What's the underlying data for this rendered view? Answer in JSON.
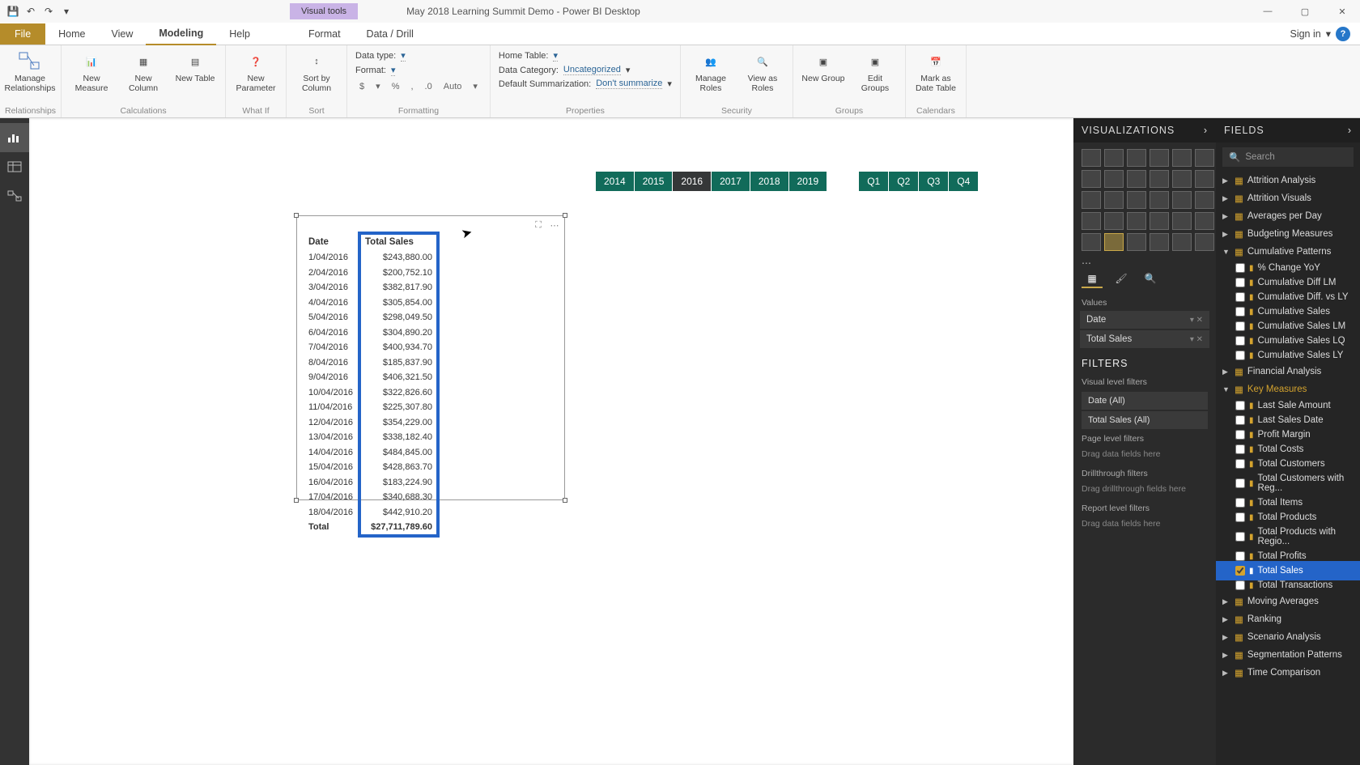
{
  "titlebar": {
    "contextual_label": "Visual tools",
    "title": "May 2018 Learning Summit Demo - Power BI Desktop"
  },
  "win_controls": {
    "min": "—",
    "max": "▢",
    "close": "✕"
  },
  "ribbon_tabs": {
    "file": "File",
    "home": "Home",
    "view": "View",
    "modeling": "Modeling",
    "help": "Help",
    "format": "Format",
    "data": "Data / Drill",
    "signin": "Sign in"
  },
  "ribbon": {
    "manage_rel": "Manage\nRelationships",
    "new_measure": "New\nMeasure",
    "new_column": "New\nColumn",
    "new_table": "New\nTable",
    "new_param": "New\nParameter",
    "sort_by": "Sort by\nColumn",
    "data_type_lbl": "Data type:",
    "format_lbl": "Format:",
    "auto": "Auto",
    "home_table_lbl": "Home Table:",
    "data_cat_lbl": "Data Category:",
    "data_cat_val": "Uncategorized",
    "summ_lbl": "Default Summarization:",
    "summ_val": "Don't summarize",
    "manage_roles": "Manage\nRoles",
    "view_as": "View as\nRoles",
    "new_group": "New\nGroup",
    "edit_groups": "Edit\nGroups",
    "mark_date": "Mark as\nDate Table",
    "groups": {
      "rel": "Relationships",
      "calc": "Calculations",
      "whatif": "What If",
      "sort": "Sort",
      "formatting": "Formatting",
      "props": "Properties",
      "security": "Security",
      "grps": "Groups",
      "cal": "Calendars"
    }
  },
  "slicers": {
    "years": [
      "2014",
      "2015",
      "2016",
      "2017",
      "2018",
      "2019"
    ],
    "quarters": [
      "Q1",
      "Q2",
      "Q3",
      "Q4"
    ],
    "year_off_index": 2
  },
  "table": {
    "head_date": "Date",
    "head_sales": "Total Sales",
    "total_label": "Total",
    "total_value": "$27,711,789.60",
    "rows": [
      {
        "d": "1/04/2016",
        "v": "$243,880.00"
      },
      {
        "d": "2/04/2016",
        "v": "$200,752.10"
      },
      {
        "d": "3/04/2016",
        "v": "$382,817.90"
      },
      {
        "d": "4/04/2016",
        "v": "$305,854.00"
      },
      {
        "d": "5/04/2016",
        "v": "$298,049.50"
      },
      {
        "d": "6/04/2016",
        "v": "$304,890.20"
      },
      {
        "d": "7/04/2016",
        "v": "$400,934.70"
      },
      {
        "d": "8/04/2016",
        "v": "$185,837.90"
      },
      {
        "d": "9/04/2016",
        "v": "$406,321.50"
      },
      {
        "d": "10/04/2016",
        "v": "$322,826.60"
      },
      {
        "d": "11/04/2016",
        "v": "$225,307.80"
      },
      {
        "d": "12/04/2016",
        "v": "$354,229.00"
      },
      {
        "d": "13/04/2016",
        "v": "$338,182.40"
      },
      {
        "d": "14/04/2016",
        "v": "$484,845.00"
      },
      {
        "d": "15/04/2016",
        "v": "$428,863.70"
      },
      {
        "d": "16/04/2016",
        "v": "$183,224.90"
      },
      {
        "d": "17/04/2016",
        "v": "$340,688.30"
      },
      {
        "d": "18/04/2016",
        "v": "$442,910.20"
      }
    ]
  },
  "viz": {
    "title": "VISUALIZATIONS",
    "values_lbl": "Values",
    "date": "Date",
    "total_sales": "Total Sales",
    "filters_lbl": "FILTERS",
    "vlf": "Visual level filters",
    "date_all": "Date (All)",
    "sales_all": "Total Sales (All)",
    "plf": "Page level filters",
    "drag": "Drag data fields here",
    "drill": "Drillthrough filters",
    "drag_drill": "Drag drillthrough fields here",
    "rlf": "Report level filters"
  },
  "fields": {
    "title": "FIELDS",
    "search": "Search",
    "tables": [
      {
        "name": "Attrition Analysis",
        "expanded": false
      },
      {
        "name": "Attrition Visuals",
        "expanded": false
      },
      {
        "name": "Averages per Day",
        "expanded": false
      },
      {
        "name": "Budgeting Measures",
        "expanded": false
      },
      {
        "name": "Cumulative Patterns",
        "expanded": true,
        "fields": [
          {
            "name": "% Change YoY"
          },
          {
            "name": "Cumulative Diff LM"
          },
          {
            "name": "Cumulative Diff. vs LY"
          },
          {
            "name": "Cumulative Sales"
          },
          {
            "name": "Cumulative Sales LM"
          },
          {
            "name": "Cumulative Sales LQ"
          },
          {
            "name": "Cumulative Sales LY"
          }
        ]
      },
      {
        "name": "Financial Analysis",
        "expanded": false
      },
      {
        "name": "Key Measures",
        "expanded": true,
        "active": true,
        "fields": [
          {
            "name": "Last Sale Amount"
          },
          {
            "name": "Last Sales Date"
          },
          {
            "name": "Profit Margin"
          },
          {
            "name": "Total Costs"
          },
          {
            "name": "Total Customers"
          },
          {
            "name": "Total Customers with Reg..."
          },
          {
            "name": "Total Items"
          },
          {
            "name": "Total Products"
          },
          {
            "name": "Total Products with Regio..."
          },
          {
            "name": "Total Profits"
          },
          {
            "name": "Total Sales",
            "checked": true,
            "hl": true
          },
          {
            "name": "Total Transactions"
          }
        ]
      },
      {
        "name": "Moving Averages",
        "expanded": false
      },
      {
        "name": "Ranking",
        "expanded": false
      },
      {
        "name": "Scenario Analysis",
        "expanded": false
      },
      {
        "name": "Segmentation Patterns",
        "expanded": false
      },
      {
        "name": "Time Comparison",
        "expanded": false
      }
    ]
  }
}
